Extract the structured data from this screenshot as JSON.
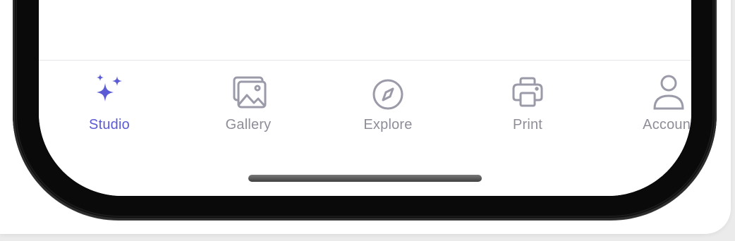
{
  "colors": {
    "accent": "#5b5bd6",
    "inactive": "#9a9aa8",
    "inactive_label": "#8e8e99"
  },
  "tab_bar": {
    "tabs": [
      {
        "label": "Studio",
        "icon": "sparkles-icon",
        "active": true
      },
      {
        "label": "Gallery",
        "icon": "photo-gallery-icon",
        "active": false
      },
      {
        "label": "Explore",
        "icon": "compass-icon",
        "active": false
      },
      {
        "label": "Print",
        "icon": "printer-icon",
        "active": false
      },
      {
        "label": "Account",
        "icon": "person-icon",
        "active": false
      }
    ]
  }
}
